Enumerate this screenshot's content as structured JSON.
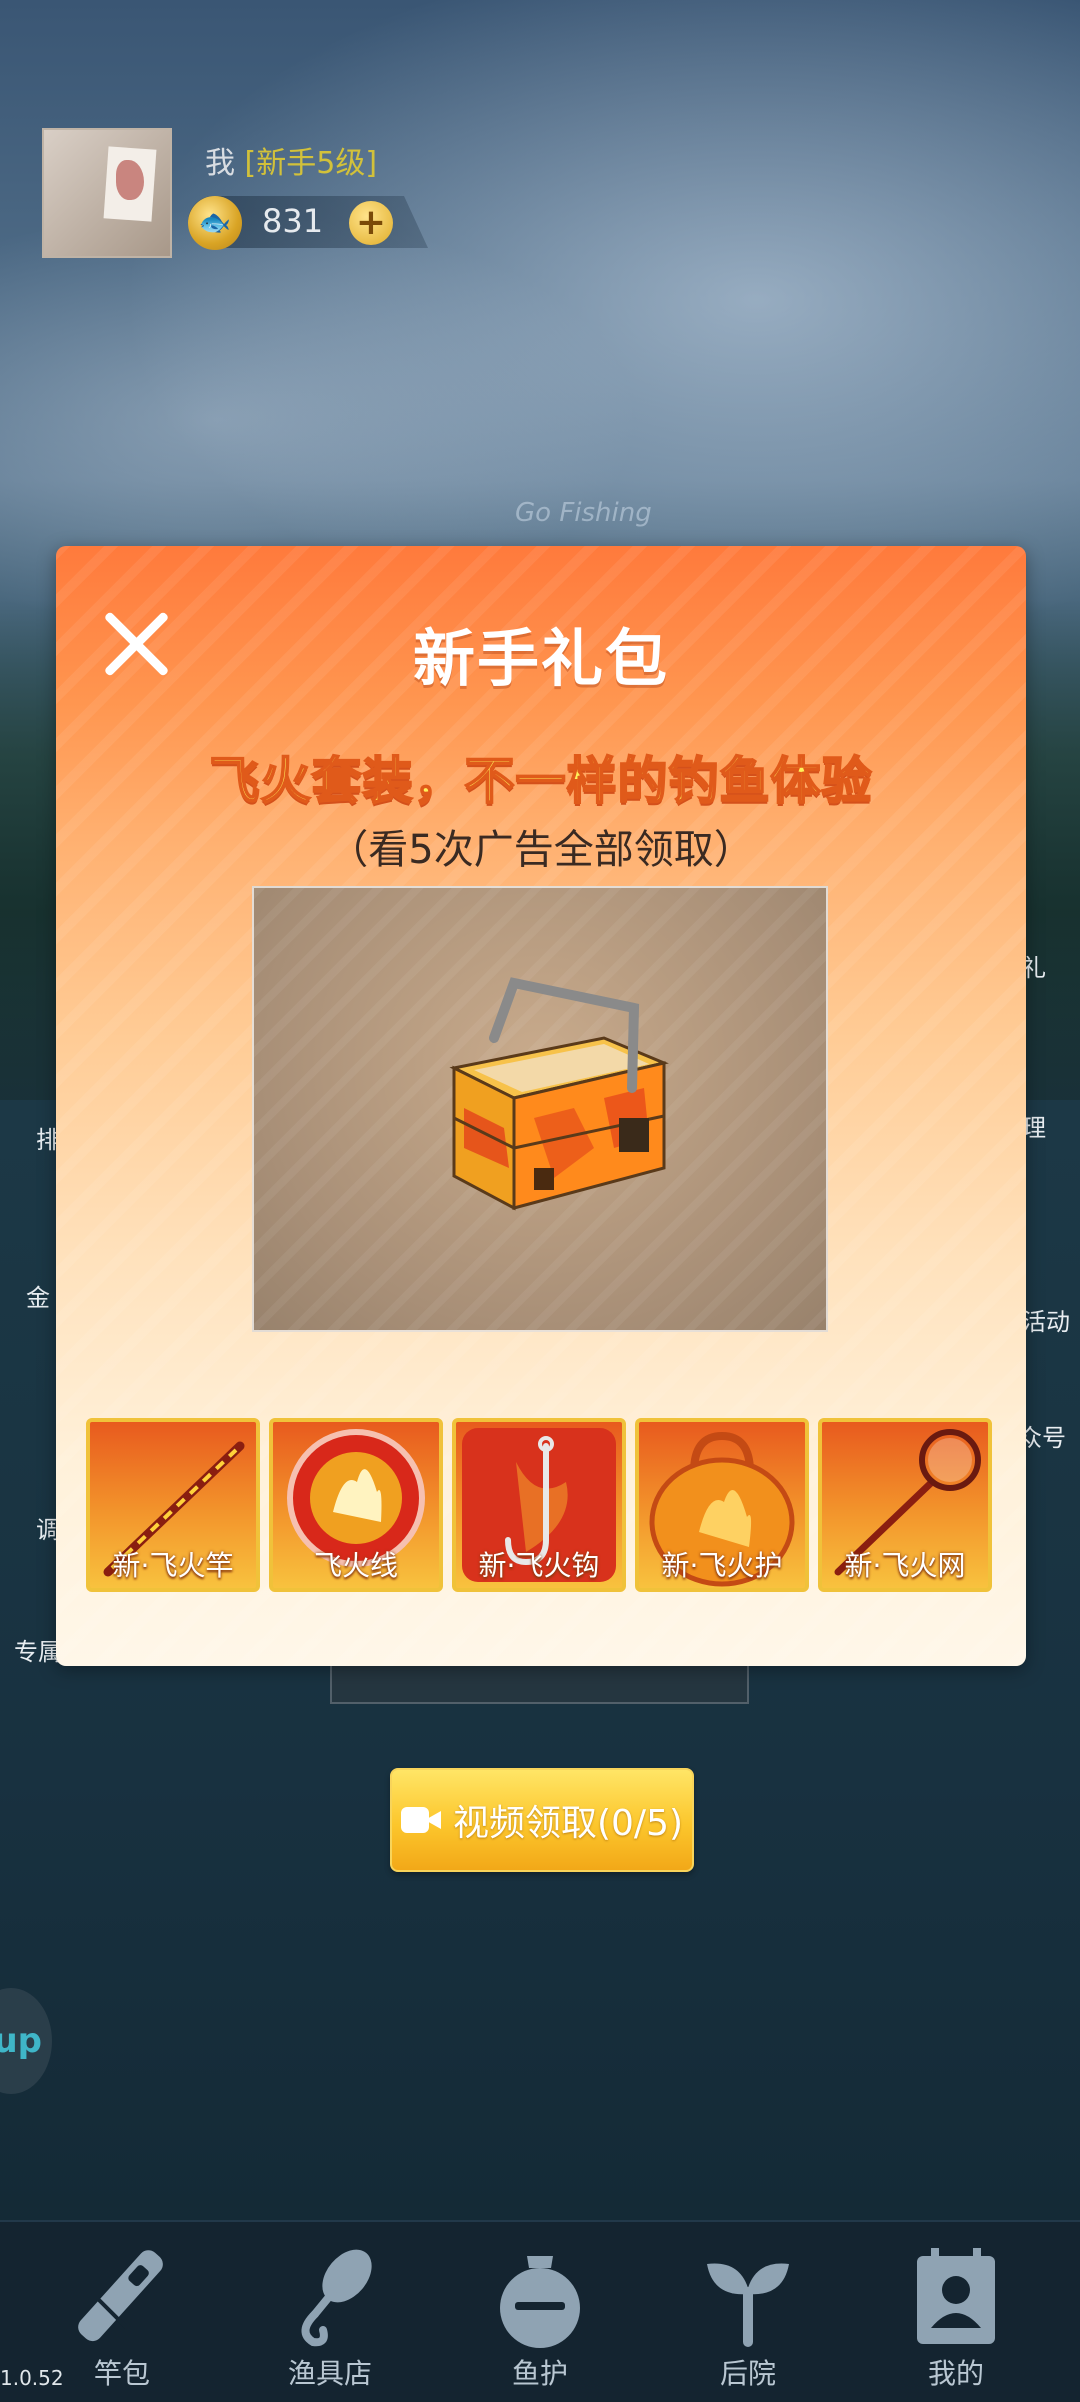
{
  "player": {
    "name": "我",
    "level": "[新手5级]",
    "coins": "831",
    "add_label": "+"
  },
  "scene": {
    "logo_text": "Go Fishing"
  },
  "side": {
    "left": [
      "排",
      "金",
      "调",
      "专属"
    ],
    "right": [
      "礼",
      "理",
      "活动",
      "众号"
    ],
    "bubble": "up"
  },
  "modal": {
    "title": "新手礼包",
    "subtitle": "飞火套装，不一样的钓鱼体验",
    "note": "（看5次广告全部领取）",
    "items": [
      {
        "label": "新·飞火竿",
        "icon": "fishing-rod-icon"
      },
      {
        "label": "飞火线",
        "icon": "fishing-line-icon"
      },
      {
        "label": "新·飞火钩",
        "icon": "fishing-hook-icon"
      },
      {
        "label": "新·飞火护",
        "icon": "fish-bag-icon"
      },
      {
        "label": "新·飞火网",
        "icon": "landing-net-icon"
      }
    ]
  },
  "video_button": {
    "label": "视频领取(0/5)"
  },
  "nav": {
    "items": [
      {
        "label": "竿包",
        "icon": "rod-bag-icon"
      },
      {
        "label": "渔具店",
        "icon": "tackle-shop-icon"
      },
      {
        "label": "鱼护",
        "icon": "fish-keeper-icon"
      },
      {
        "label": "后院",
        "icon": "sprout-icon"
      },
      {
        "label": "我的",
        "icon": "profile-icon"
      }
    ]
  },
  "version": "1.0.52",
  "colors": {
    "modal_top": "#ff7a3c",
    "modal_bottom": "#fff7e9",
    "accent_yellow": "#fcc62c",
    "subtitle": "#fff15a"
  }
}
